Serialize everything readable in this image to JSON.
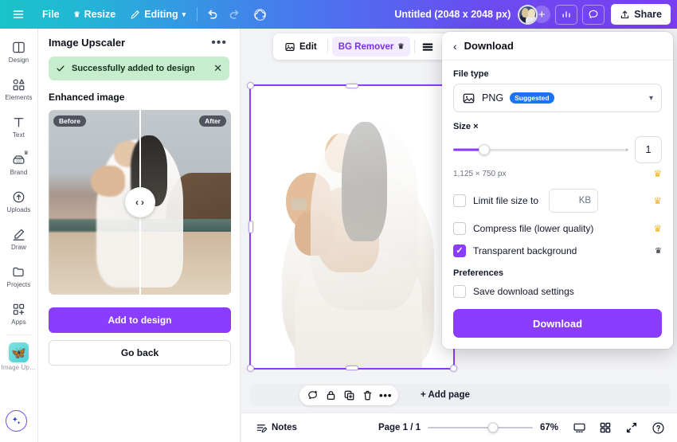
{
  "topbar": {
    "menu_icon": "hamburger-menu-icon",
    "file_label": "File",
    "resize_label": "Resize",
    "editing_label": "Editing",
    "undo_icon": "undo-icon",
    "redo_icon": "redo-icon",
    "cloudsave_icon": "cloud-save-icon",
    "doc_title": "Untitled (2048 x 2048 px)",
    "avatar_name": "user-avatar",
    "add_collaborator": "+",
    "insights_icon": "insights-bar-chart-icon",
    "comment_icon": "comment-bubble-icon",
    "share_label": "Share",
    "gradient_start": "#18c4c8",
    "gradient_end": "#7a3df2"
  },
  "rail": {
    "items": [
      {
        "label": "Design",
        "icon": "design-layout-icon"
      },
      {
        "label": "Elements",
        "icon": "elements-shapes-icon"
      },
      {
        "label": "Text",
        "icon": "text-t-icon"
      },
      {
        "label": "Brand",
        "icon": "brand-kit-icon"
      },
      {
        "label": "Uploads",
        "icon": "uploads-cloud-icon"
      },
      {
        "label": "Draw",
        "icon": "draw-pen-icon"
      },
      {
        "label": "Projects",
        "icon": "projects-folder-icon"
      },
      {
        "label": "Apps",
        "icon": "apps-grid-plus-icon"
      }
    ],
    "app_tile": {
      "label": "Image Ups...",
      "icon": "butterfly-icon",
      "glyph": "🦋"
    },
    "magic_button": "magic-sparkle-button"
  },
  "panel": {
    "title": "Image Upscaler",
    "more_icon": "more-options-icon",
    "toast": {
      "text": "Successfully added to design",
      "check_icon": "check-icon",
      "close_icon": "close-icon",
      "bg": "#c8ecce"
    },
    "section_title": "Enhanced image",
    "compare": {
      "before_label": "Before",
      "after_label": "After",
      "prev_icon": "chevron-left-icon",
      "next_icon": "chevron-right-icon"
    },
    "primary_button": "Add to design",
    "secondary_button": "Go back",
    "accent": "#8b3dff"
  },
  "editor": {
    "element_toolbar": {
      "edit_label": "Edit",
      "edit_icon": "edit-image-icon",
      "bg_remover_label": "BG Remover",
      "bg_remover_crown": "crown-icon",
      "adjust_icon": "adjust-lines-icon",
      "corner_icon": "corner-radius-icon"
    },
    "page_toolbar": {
      "comment_icon": "comment-add-icon",
      "lock_icon": "lock-icon",
      "duplicate_icon": "duplicate-page-icon",
      "delete_icon": "trash-delete-icon",
      "more_icon": "more-options-icon",
      "add_page_label": "+ Add page"
    },
    "selection_color": "#8b3dff"
  },
  "bottombar": {
    "notes_label": "Notes",
    "notes_icon": "notes-icon",
    "page_indicator": "Page 1 / 1",
    "zoom_value": "67%",
    "zoom_percent": 67,
    "grid_view_icon": "page-view-icon",
    "thumbnails_icon": "grid-thumbnails-icon",
    "fullscreen_icon": "fullscreen-expand-icon",
    "help_icon": "help-question-icon"
  },
  "download": {
    "back_icon": "chevron-left-icon",
    "title": "Download",
    "file_type_label": "File type",
    "file_type_value": "PNG",
    "file_type_icon": "image-file-icon",
    "file_type_badge": "Suggested",
    "caret_icon": "chevron-down-icon",
    "size_label": "Size ×",
    "size_value": "1",
    "size_percent": 18,
    "dimensions": "1,125 × 750 px",
    "options": [
      {
        "label": "Limit file size to",
        "checked": false,
        "has_input": true,
        "input_unit": "KB",
        "crown": "gold"
      },
      {
        "label": "Compress file (lower quality)",
        "checked": false,
        "has_input": false,
        "crown": "gold"
      },
      {
        "label": "Transparent background",
        "checked": true,
        "has_input": false,
        "crown": "dark"
      }
    ],
    "preferences_label": "Preferences",
    "save_settings_label": "Save download settings",
    "save_settings_checked": false,
    "download_button": "Download",
    "accent": "#8b3dff",
    "badge_color": "#1a73f0",
    "crown_gold": "#f5b820"
  }
}
